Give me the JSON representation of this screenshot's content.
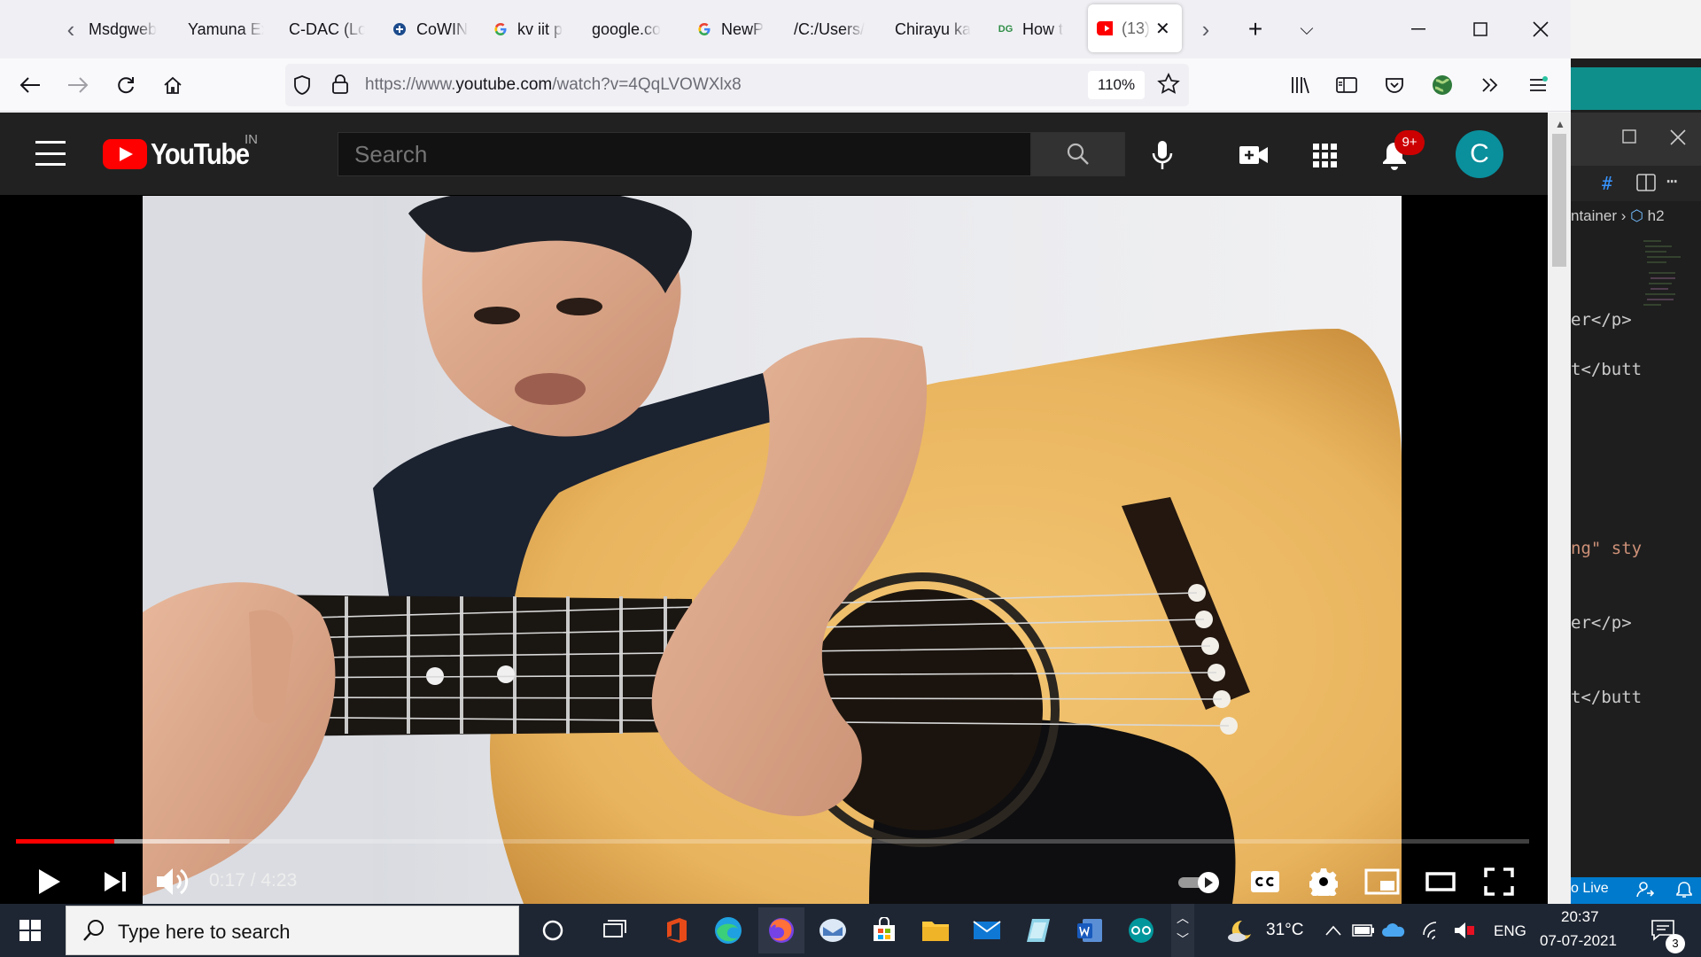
{
  "browser": {
    "tabs": [
      {
        "label": "Msdgweb",
        "favicon": "none"
      },
      {
        "label": "Yamuna Ex",
        "favicon": "none"
      },
      {
        "label": "C-DAC (Lo",
        "favicon": "none"
      },
      {
        "label": "CoWIN",
        "favicon": "cowin-icon"
      },
      {
        "label": "kv iit p",
        "favicon": "google-icon"
      },
      {
        "label": "google.co",
        "favicon": "none"
      },
      {
        "label": "NewP",
        "favicon": "google-icon"
      },
      {
        "label": "/C:/Users/",
        "favicon": "none"
      },
      {
        "label": "Chirayu ka",
        "favicon": "none"
      },
      {
        "label": "How t",
        "favicon": "dg-icon",
        "favicon_text": "DG"
      },
      {
        "label": "(13)",
        "favicon": "youtube-icon",
        "active": true
      }
    ],
    "url_prefix": "https://www.",
    "url_domain": "youtube.com",
    "url_suffix": "/watch?v=4QqLVOWXlx8",
    "zoom": "110%"
  },
  "youtube": {
    "logo_text": "YouTube",
    "country_code": "IN",
    "search_placeholder": "Search",
    "notification_count": "9+",
    "avatar_initial": "C",
    "player": {
      "current_time": "0:17",
      "duration": "4:23",
      "time_display": "0:17 / 4:23",
      "progress_fraction": 0.065,
      "buffered_fraction": 0.141
    }
  },
  "vscode": {
    "breadcrumb_tail": "ntainer",
    "breadcrumb_tag": "h2",
    "code_lines": [
      "er</p>",
      "t</butt",
      "ng\" sty",
      "er</p>",
      "t</butt"
    ],
    "status_live": "o Live",
    "hash_symbol": "#"
  },
  "taskbar": {
    "search_placeholder": "Type here to search",
    "weather": "31°C",
    "language": "ENG",
    "time": "20:37",
    "date": "07-07-2021",
    "notification_count": "3"
  },
  "colors": {
    "youtube_red": "#ff0000",
    "taskbar_bg": "#1f2633",
    "avatar": "#0a8f9c"
  }
}
